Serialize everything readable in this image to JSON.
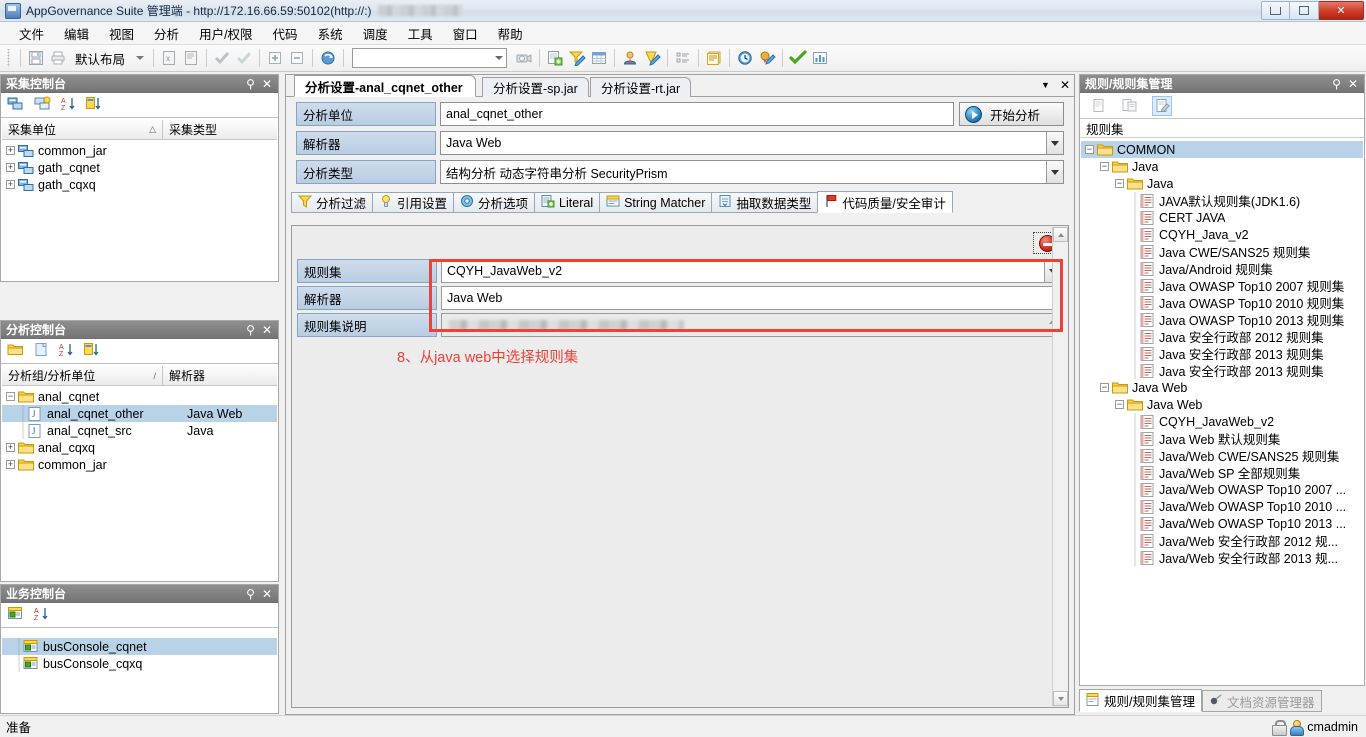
{
  "window": {
    "title": "AppGovernance Suite 管理端 - http://172.16.66.59:50102(http://:)",
    "app_icon": "app-icon",
    "minimize": "—",
    "maximize": "❐",
    "close": "✕"
  },
  "menubar": {
    "items": [
      {
        "label": "文件"
      },
      {
        "label": "编辑"
      },
      {
        "label": "视图"
      },
      {
        "label": "分析"
      },
      {
        "label": "用户/权限"
      },
      {
        "label": "代码"
      },
      {
        "label": "系统"
      },
      {
        "label": "调度"
      },
      {
        "label": "工具"
      },
      {
        "label": "窗口"
      },
      {
        "label": "帮助"
      }
    ]
  },
  "toolbar": {
    "layout_value": "默认布局",
    "search_value": "",
    "icons": [
      "save-icon",
      "print-icon",
      "export-excel-icon",
      "export-pdf-icon",
      "check-icon",
      "uncheck-icon",
      "expand-all-icon",
      "collapse-all-icon",
      "refresh-icon",
      "camera-icon",
      "new-doc-icon",
      "edit-filter-icon",
      "table-icon",
      "user-icon",
      "shield-edit-icon",
      "list-icon",
      "report-icon",
      "clock-icon",
      "sign-icon",
      "approve-check-icon",
      "chart-icon"
    ]
  },
  "collect_console": {
    "title": "采集控制台",
    "pin": "⚲",
    "close": "✕",
    "toolbar_icons": [
      "add-collect-icon",
      "copy-collect-icon",
      "sort-az-icon",
      "sort-custom-icon"
    ],
    "columns": [
      "采集单位",
      "采集类型"
    ],
    "sort_mark": "△",
    "rows": [
      {
        "label": "common_jar",
        "type": "",
        "icon": "collect-unit-icon",
        "expander": "+"
      },
      {
        "label": "gath_cqnet",
        "type": "",
        "icon": "collect-unit-icon",
        "expander": "+"
      },
      {
        "label": "gath_cqxq",
        "type": "",
        "icon": "collect-unit-icon",
        "expander": "+"
      }
    ]
  },
  "analysis_console": {
    "title": "分析控制台",
    "pin": "⚲",
    "close": "✕",
    "toolbar_icons": [
      "folder-icon",
      "new-file-icon",
      "sort-az-icon",
      "sort-custom-icon"
    ],
    "columns": [
      "分析组/分析单位",
      "解析器"
    ],
    "sort_mark": "/",
    "rows": [
      {
        "label": "anal_cqnet",
        "parser": "",
        "icon": "folder-open-icon",
        "expander": "−",
        "indent": 0,
        "selected": false
      },
      {
        "label": "anal_cqnet_other",
        "parser": "Java Web",
        "icon": "java-file-icon",
        "expander": "",
        "indent": 1,
        "selected": true
      },
      {
        "label": "anal_cqnet_src",
        "parser": "Java",
        "icon": "java-file-icon",
        "expander": "",
        "indent": 1,
        "selected": false
      },
      {
        "label": "anal_cqxq",
        "parser": "",
        "icon": "folder-open-icon",
        "expander": "+",
        "indent": 0,
        "selected": false
      },
      {
        "label": "common_jar",
        "parser": "",
        "icon": "folder-open-icon",
        "expander": "+",
        "indent": 0,
        "selected": false
      }
    ]
  },
  "business_console": {
    "title": "业务控制台",
    "pin": "⚲",
    "close": "✕",
    "toolbar_icons": [
      "business-unit-icon",
      "sort-az-icon"
    ],
    "rows": [
      {
        "label": "busConsole_cqnet",
        "icon": "business-unit-icon",
        "selected": true
      },
      {
        "label": "busConsole_cqxq",
        "icon": "business-unit-icon",
        "selected": false
      }
    ]
  },
  "editor": {
    "tabs": [
      {
        "label": "分析设置-anal_cqnet_other",
        "active": true
      },
      {
        "label": "分析设置-sp.jar",
        "active": false
      },
      {
        "label": "分析设置-rt.jar",
        "active": false
      }
    ],
    "tab_menu_icon": "chevron-down-icon",
    "tab_close_icon": "close-icon",
    "fields": [
      {
        "label": "分析单位",
        "value": "anal_cqnet_other",
        "type": "text"
      },
      {
        "label": "解析器",
        "value": "Java Web",
        "type": "combo"
      },
      {
        "label": "分析类型",
        "value": "结构分析 动态字符串分析 SecurityPrism",
        "type": "combo"
      }
    ],
    "start_button": "开始分析",
    "start_icon": "play-icon",
    "subtabs": [
      {
        "label": "分析过滤",
        "icon": "filter-icon",
        "active": false
      },
      {
        "label": "引用设置",
        "icon": "bulb-icon",
        "active": false
      },
      {
        "label": "分析选项",
        "icon": "gear-icon",
        "active": false
      },
      {
        "label": "Literal",
        "icon": "literal-icon",
        "active": false
      },
      {
        "label": "String Matcher",
        "icon": "string-matcher-icon",
        "active": false
      },
      {
        "label": "抽取数据类型",
        "icon": "extract-icon",
        "active": false
      },
      {
        "label": "代码质量/安全审计",
        "icon": "flag-icon",
        "active": true
      }
    ],
    "stop_button_icon": "stop-icon",
    "rule_fields": [
      {
        "label": "规则集",
        "value": "CQYH_JavaWeb_v2",
        "type": "combo"
      },
      {
        "label": "解析器",
        "value": "Java Web",
        "type": "readonly"
      },
      {
        "label": "规则集说明",
        "value": "",
        "type": "redacted"
      }
    ],
    "annotation": "8、从java web中选择规则集",
    "annotation_color": "#ef4136"
  },
  "rule_panel": {
    "title": "规则/规则集管理",
    "pin": "⚲",
    "close": "✕",
    "toolbar_icons": [
      "rule-new-icon",
      "rule-group-icon",
      "ruleset-edit-icon"
    ],
    "header": "规则集",
    "tree": [
      {
        "label": "COMMON",
        "depth": 0,
        "expander": "−",
        "icon": "folder-open-icon",
        "selected": true
      },
      {
        "label": "Java",
        "depth": 1,
        "expander": "−",
        "icon": "folder-open-icon",
        "selected": false
      },
      {
        "label": "Java",
        "depth": 2,
        "expander": "−",
        "icon": "folder-open-icon",
        "selected": false
      },
      {
        "label": "JAVA默认规则集(JDK1.6)",
        "depth": 3,
        "expander": "",
        "icon": "ruleset-icon",
        "selected": false
      },
      {
        "label": "CERT JAVA",
        "depth": 3,
        "expander": "",
        "icon": "ruleset-icon",
        "selected": false
      },
      {
        "label": "CQYH_Java_v2",
        "depth": 3,
        "expander": "",
        "icon": "ruleset-icon",
        "selected": false
      },
      {
        "label": "Java CWE/SANS25 规则集",
        "depth": 3,
        "expander": "",
        "icon": "ruleset-icon",
        "selected": false
      },
      {
        "label": "Java/Android 规则集",
        "depth": 3,
        "expander": "",
        "icon": "ruleset-icon",
        "selected": false
      },
      {
        "label": "Java OWASP Top10 2007 规则集",
        "depth": 3,
        "expander": "",
        "icon": "ruleset-icon",
        "selected": false
      },
      {
        "label": "Java OWASP Top10 2010 规则集",
        "depth": 3,
        "expander": "",
        "icon": "ruleset-icon",
        "selected": false
      },
      {
        "label": "Java OWASP Top10 2013 规则集",
        "depth": 3,
        "expander": "",
        "icon": "ruleset-icon",
        "selected": false
      },
      {
        "label": "Java 安全行政部 2012 规则集",
        "depth": 3,
        "expander": "",
        "icon": "ruleset-icon",
        "selected": false
      },
      {
        "label": "Java 安全行政部 2013 规则集",
        "depth": 3,
        "expander": "",
        "icon": "ruleset-icon",
        "selected": false
      },
      {
        "label": "Java 安全行政部 2013 规则集",
        "depth": 3,
        "expander": "",
        "icon": "ruleset-icon",
        "selected": false
      },
      {
        "label": "Java Web",
        "depth": 1,
        "expander": "−",
        "icon": "folder-open-icon",
        "selected": false
      },
      {
        "label": "Java Web",
        "depth": 2,
        "expander": "−",
        "icon": "folder-open-icon",
        "selected": false
      },
      {
        "label": "CQYH_JavaWeb_v2",
        "depth": 3,
        "expander": "",
        "icon": "ruleset-icon",
        "selected": false
      },
      {
        "label": "Java Web 默认规则集",
        "depth": 3,
        "expander": "",
        "icon": "ruleset-icon",
        "selected": false
      },
      {
        "label": "Java/Web CWE/SANS25 规则集",
        "depth": 3,
        "expander": "",
        "icon": "ruleset-icon",
        "selected": false
      },
      {
        "label": "Java/Web SP 全部规则集",
        "depth": 3,
        "expander": "",
        "icon": "ruleset-icon",
        "selected": false
      },
      {
        "label": "Java/Web OWASP Top10 2007 ...",
        "depth": 3,
        "expander": "",
        "icon": "ruleset-icon",
        "selected": false
      },
      {
        "label": "Java/Web OWASP Top10 2010 ...",
        "depth": 3,
        "expander": "",
        "icon": "ruleset-icon",
        "selected": false
      },
      {
        "label": "Java/Web OWASP Top10 2013 ...",
        "depth": 3,
        "expander": "",
        "icon": "ruleset-icon",
        "selected": false
      },
      {
        "label": "Java/Web 安全行政部 2012 规...",
        "depth": 3,
        "expander": "",
        "icon": "ruleset-icon",
        "selected": false
      },
      {
        "label": "Java/Web 安全行政部 2013 规...",
        "depth": 3,
        "expander": "",
        "icon": "ruleset-icon",
        "selected": false
      }
    ],
    "bottom_tabs": [
      {
        "label": "规则/规则集管理",
        "icon": "rule-manage-icon",
        "active": true
      },
      {
        "label": "文档资源管理器",
        "icon": "doc-explorer-icon",
        "active": false
      }
    ]
  },
  "statusbar": {
    "text": "准备",
    "user": "cmadmin",
    "lock_icon": "lock-icon",
    "user_icon": "user-icon"
  }
}
